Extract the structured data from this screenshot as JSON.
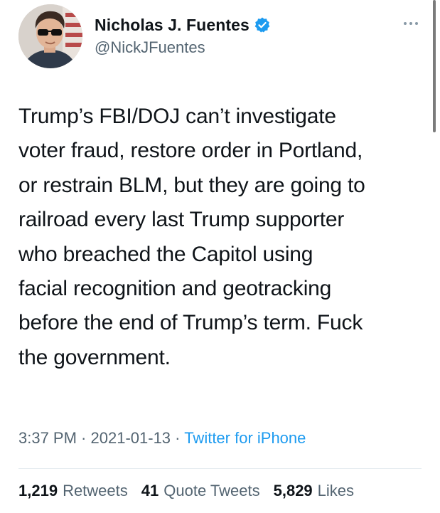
{
  "author": {
    "display_name": "Nicholas J. Fuentes",
    "handle": "@NickJFuentes",
    "verified": true,
    "avatar_icon": "profile-photo"
  },
  "more_icon": "more-horizontal-icon",
  "tweet": {
    "lines": [
      "Trump’s FBI/DOJ can’t investigate",
      "voter fraud, restore order in Portland,",
      "or restrain BLM, but they are going to",
      "railroad every last Trump supporter",
      "who breached the Capitol using",
      "facial recognition and geotracking",
      "before the end of Trump’s term. Fuck",
      "the government."
    ]
  },
  "meta": {
    "time": "3:37 PM",
    "separator": " · ",
    "date": "2021-01-13",
    "source": "Twitter for iPhone"
  },
  "stats": [
    {
      "count": "1,219",
      "label": "Retweets"
    },
    {
      "count": "41",
      "label": "Quote Tweets"
    },
    {
      "count": "5,829",
      "label": "Likes"
    }
  ],
  "colors": {
    "text": "#0f1419",
    "secondary": "#536471",
    "link": "#1d9bf0",
    "verified": "#1d9bf0"
  }
}
